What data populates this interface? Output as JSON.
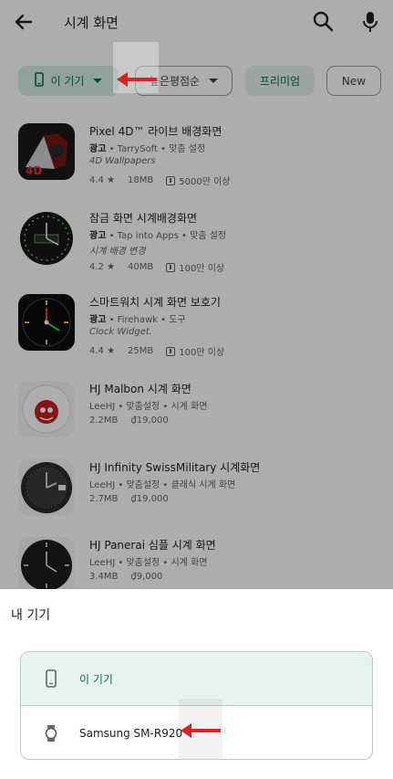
{
  "header": {
    "query": "시계 화면",
    "back_icon": "back-arrow-icon",
    "search_icon": "search-icon",
    "mic_icon": "mic-icon"
  },
  "filters": {
    "device_chip": "이 기기",
    "sort_chip": "높은평점순",
    "premium_chip": "프리미엄",
    "new_chip": "New"
  },
  "apps": [
    {
      "title": "Pixel 4D™ 라이브 배경화면",
      "ad": "광고",
      "developer": "TarrySoft",
      "tag": "맞춤 설정",
      "desc": "4D Wallpapers",
      "rating": "4.4 ★",
      "size": "18MB",
      "downloads": "5000만 이상"
    },
    {
      "title": "잠금 화면 시계배경화면",
      "ad": "광고",
      "developer": "Tap into Apps",
      "tag": "맞춤 설정",
      "desc": "시계 배경 변경",
      "rating": "4.2 ★",
      "size": "40MB",
      "downloads": "100만 이상"
    },
    {
      "title": "스마트워치 시계 화면 보호기",
      "ad": "광고",
      "developer": "Firehawk",
      "tag": "도구",
      "desc": "Clock Widget.",
      "rating": "4.4 ★",
      "size": "25MB",
      "downloads": "100만 이상"
    },
    {
      "title": "HJ Malbon 시계 화면",
      "developer": "LeeHJ",
      "tag": "맞춤설정",
      "tag2": "시계 화면",
      "size": "2.2MB",
      "price": "₫19,000"
    },
    {
      "title": "HJ Infinity SwissMilitary 시계화면",
      "developer": "LeeHJ",
      "tag": "맞춤설정",
      "tag2": "클래식 시계 화면",
      "size": "2.7MB",
      "price": "₫19,000"
    },
    {
      "title": "HJ Panerai 심플 시계 화면",
      "developer": "LeeHJ",
      "tag": "맞춤설정",
      "tag2": "시계 화면",
      "size": "3.4MB",
      "price": "₫9,000"
    }
  ],
  "sheet": {
    "title": "내 기기",
    "devices": [
      {
        "label": "이 기기",
        "icon": "phone-icon",
        "selected": true
      },
      {
        "label": "Samsung SM-R920",
        "icon": "watch-icon",
        "selected": false
      }
    ]
  },
  "colors": {
    "accent": "#0d6b4a",
    "selected_bg": "#e6f4ef",
    "annotation_arrow": "#e02020"
  }
}
